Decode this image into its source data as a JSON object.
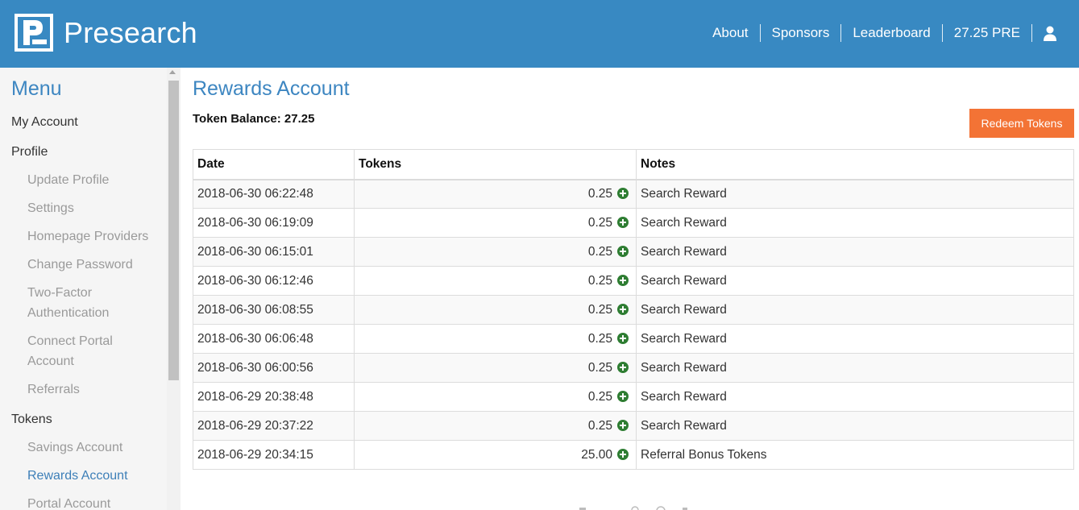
{
  "header": {
    "brand": "Presearch",
    "nav": [
      "About",
      "Sponsors",
      "Leaderboard",
      "27.25 PRE"
    ],
    "bg_color": "#3889c2"
  },
  "sidebar": {
    "title": "Menu",
    "items": [
      {
        "label": "My Account",
        "level": "top"
      },
      {
        "label": "Profile",
        "level": "top"
      },
      {
        "label": "Update Profile",
        "level": "sub"
      },
      {
        "label": "Settings",
        "level": "sub"
      },
      {
        "label": "Homepage Providers",
        "level": "sub"
      },
      {
        "label": "Change Password",
        "level": "sub"
      },
      {
        "label": "Two-Factor",
        "level": "sub"
      },
      {
        "label": "Authentication",
        "level": "sub"
      },
      {
        "label": "Connect Portal",
        "level": "sub"
      },
      {
        "label": "Account",
        "level": "sub"
      },
      {
        "label": "Referrals",
        "level": "sub"
      },
      {
        "label": "Tokens",
        "level": "top"
      },
      {
        "label": "Savings Account",
        "level": "sub"
      },
      {
        "label": "Rewards Account",
        "level": "sub",
        "active": true
      },
      {
        "label": "Portal Account",
        "level": "sub"
      }
    ]
  },
  "main": {
    "title": "Rewards Account",
    "balance_label": "Token Balance: 27.25",
    "redeem_label": "Redeem Tokens",
    "accent_color": "#f37335",
    "table": {
      "headers": [
        "Date",
        "Tokens",
        "Notes"
      ],
      "rows": [
        {
          "date": "2018-06-30 06:22:48",
          "tokens": "0.25",
          "note": "Search Reward"
        },
        {
          "date": "2018-06-30 06:19:09",
          "tokens": "0.25",
          "note": "Search Reward"
        },
        {
          "date": "2018-06-30 06:15:01",
          "tokens": "0.25",
          "note": "Search Reward"
        },
        {
          "date": "2018-06-30 06:12:46",
          "tokens": "0.25",
          "note": "Search Reward"
        },
        {
          "date": "2018-06-30 06:08:55",
          "tokens": "0.25",
          "note": "Search Reward"
        },
        {
          "date": "2018-06-30 06:06:48",
          "tokens": "0.25",
          "note": "Search Reward"
        },
        {
          "date": "2018-06-30 06:00:56",
          "tokens": "0.25",
          "note": "Search Reward"
        },
        {
          "date": "2018-06-29 20:38:48",
          "tokens": "0.25",
          "note": "Search Reward"
        },
        {
          "date": "2018-06-29 20:37:22",
          "tokens": "0.25",
          "note": "Search Reward"
        },
        {
          "date": "2018-06-29 20:34:15",
          "tokens": "25.00",
          "note": "Referral Bonus Tokens"
        }
      ]
    }
  }
}
